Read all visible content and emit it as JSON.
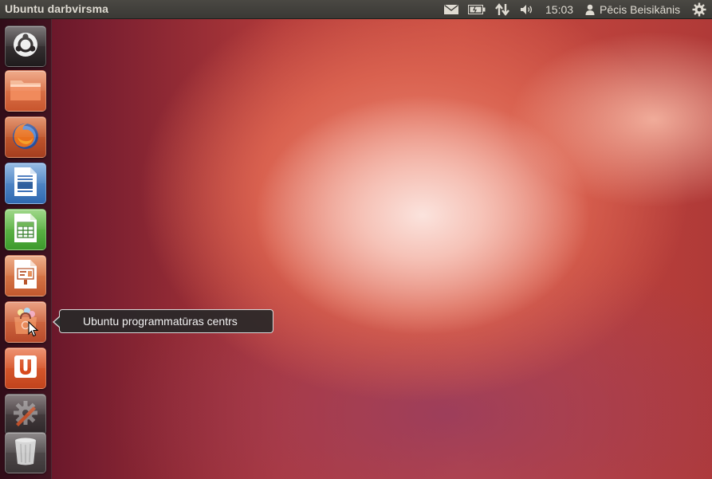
{
  "top_panel": {
    "title": "Ubuntu darbvirsma",
    "clock": "15:03",
    "username": "Pēcis Beisikānis",
    "indicators": [
      "mail-icon",
      "battery-icon",
      "network-icon",
      "volume-icon",
      "user-icon",
      "gear-icon"
    ]
  },
  "launcher": {
    "items": [
      {
        "name": "dash-home",
        "icon": "ubuntu-logo-icon"
      },
      {
        "name": "files",
        "icon": "folder-icon"
      },
      {
        "name": "firefox",
        "icon": "firefox-icon"
      },
      {
        "name": "libreoffice-writer",
        "icon": "writer-icon"
      },
      {
        "name": "libreoffice-calc",
        "icon": "calc-icon"
      },
      {
        "name": "libreoffice-impress",
        "icon": "impress-icon"
      },
      {
        "name": "ubuntu-software-center",
        "icon": "shopping-bag-icon"
      },
      {
        "name": "ubuntu-one",
        "icon": "ubuntu-one-icon"
      },
      {
        "name": "system-settings",
        "icon": "settings-icon"
      },
      {
        "name": "trash",
        "icon": "trash-icon"
      }
    ]
  },
  "tooltip": {
    "text": "Ubuntu programmatūras centrs"
  },
  "colors": {
    "panel": "#3c3b37",
    "accent": "#dd4814",
    "tooltip_bg": "#282828"
  }
}
